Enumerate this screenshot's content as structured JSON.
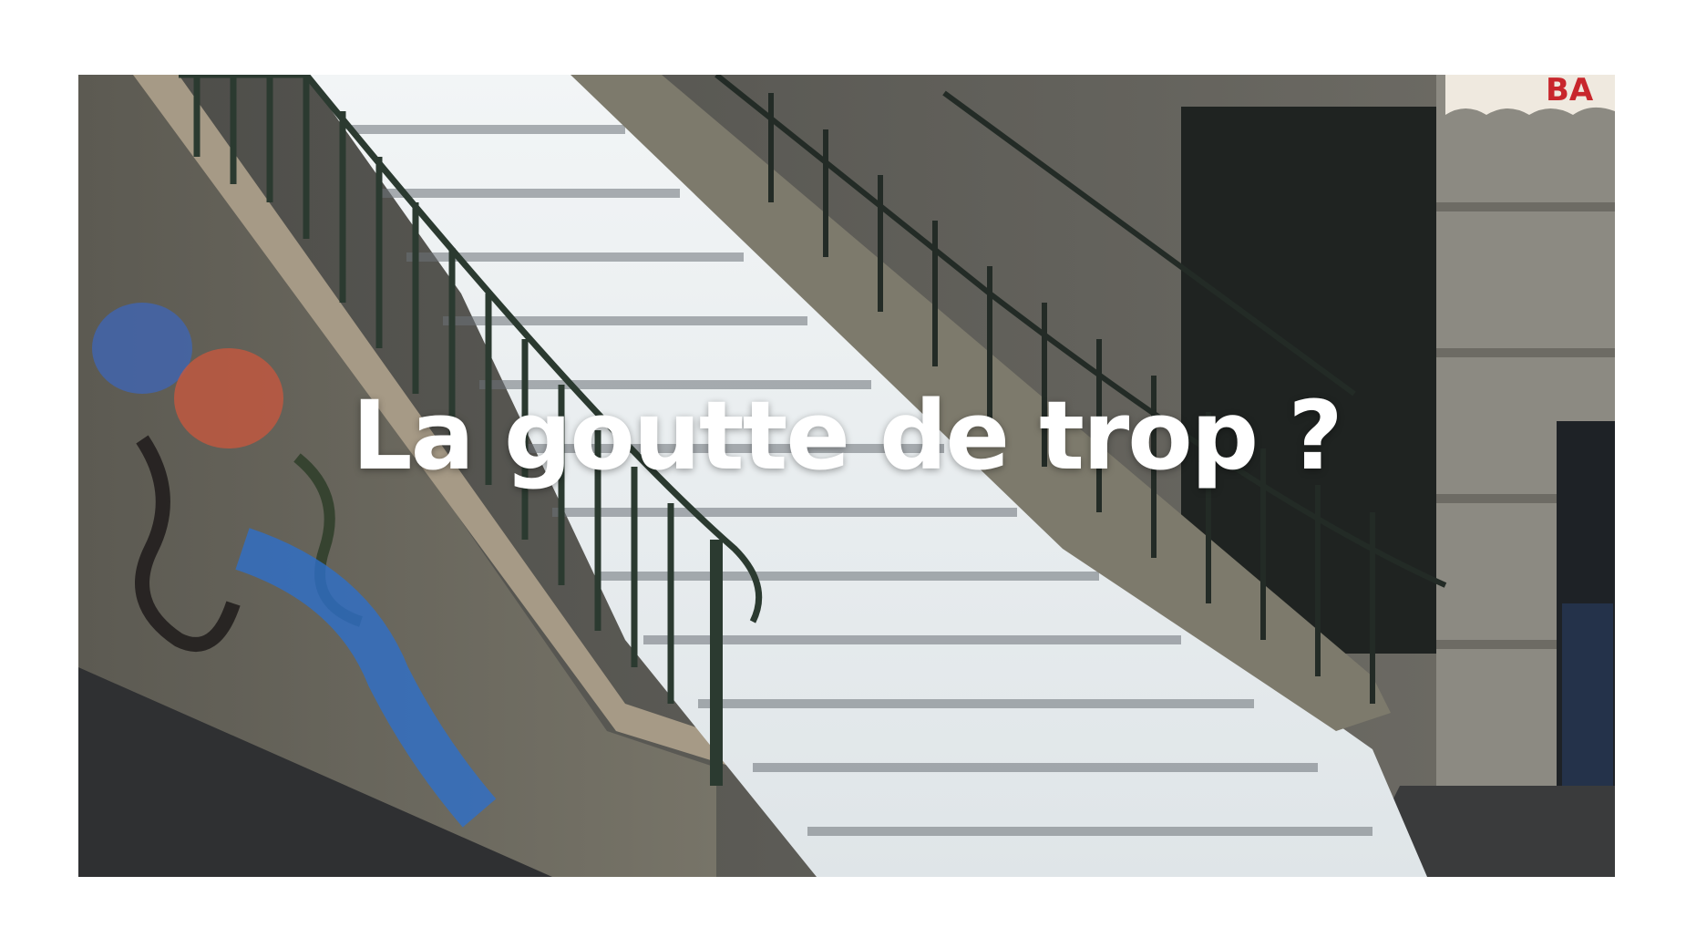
{
  "headline": {
    "text": "La goutte de trop ?"
  },
  "photo": {
    "awning_text": "BA",
    "colors": {
      "text": "#ffffff",
      "water": "#e9eef0",
      "stone": "#9b8f7c",
      "railing": "#2b3a30",
      "awning_red": "#c8262c"
    }
  }
}
